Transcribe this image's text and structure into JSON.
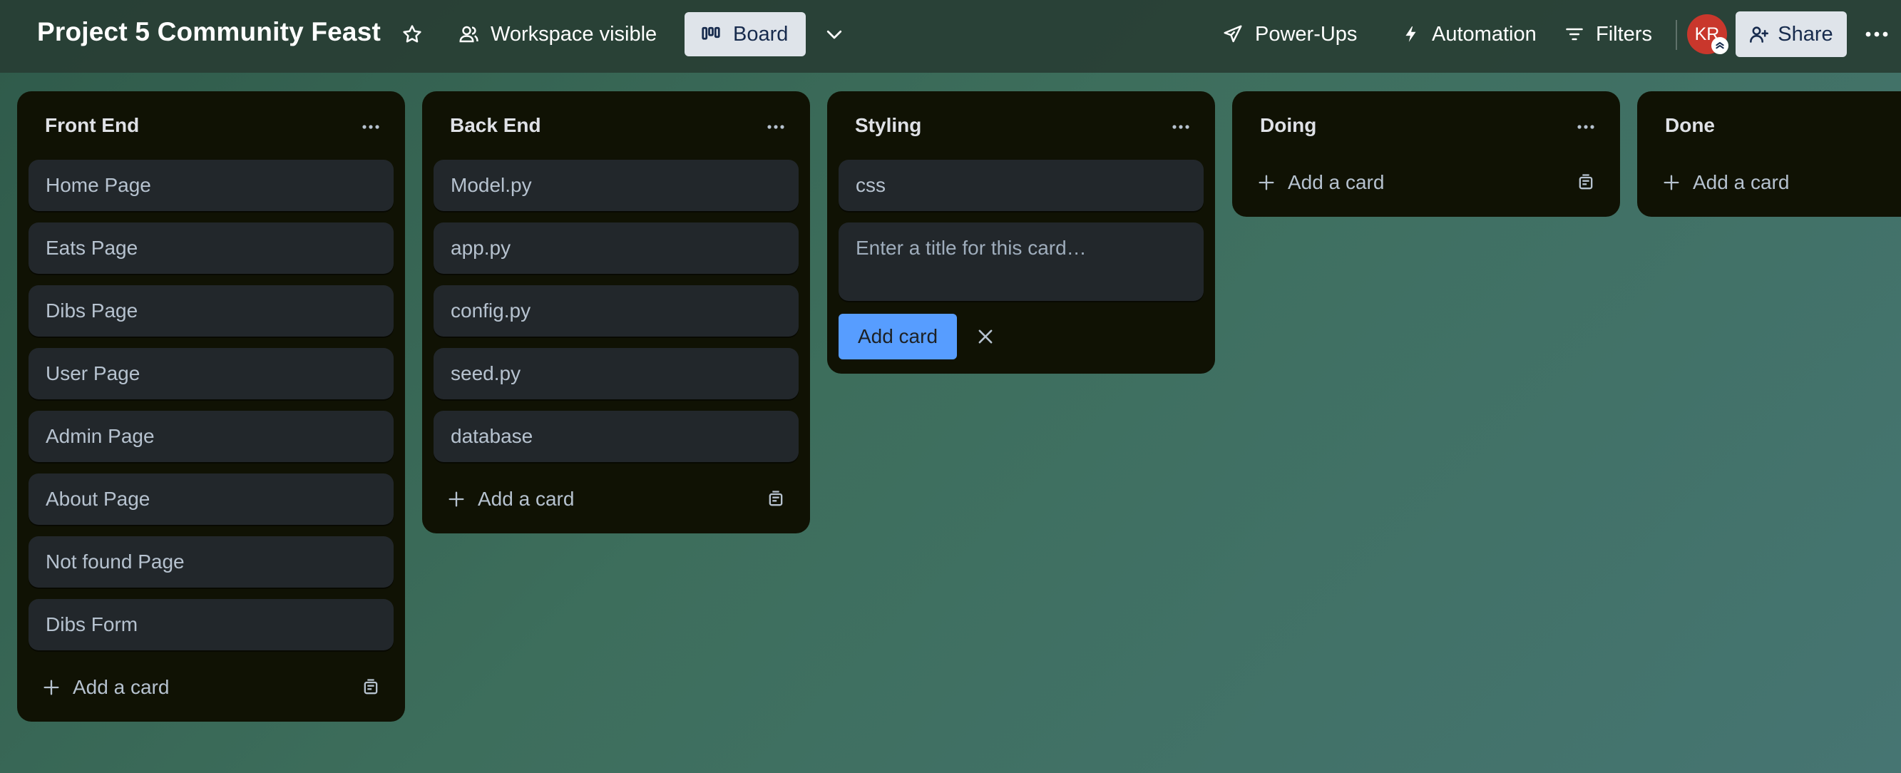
{
  "header": {
    "board_title": "Project 5 Community Feast",
    "visibility_label": "Workspace visible",
    "view_label": "Board",
    "powerups_label": "Power-Ups",
    "automation_label": "Automation",
    "filters_label": "Filters",
    "avatar_initials": "KR",
    "share_label": "Share"
  },
  "lists": [
    {
      "title": "Front End",
      "cards": [
        "Home Page",
        "Eats Page",
        "Dibs Page",
        "User Page",
        "Admin Page",
        "About Page",
        "Not found Page",
        "Dibs Form"
      ],
      "add_label": "Add a card"
    },
    {
      "title": "Back End",
      "cards": [
        "Model.py",
        "app.py",
        "config.py",
        "seed.py",
        "database"
      ],
      "add_label": "Add a card"
    },
    {
      "title": "Styling",
      "cards": [
        "css"
      ],
      "composer": {
        "placeholder": "Enter a title for this card…",
        "submit_label": "Add card"
      }
    },
    {
      "title": "Doing",
      "cards": [],
      "add_label": "Add a card"
    },
    {
      "title": "Done",
      "cards": [],
      "add_label": "Add a card"
    }
  ],
  "colors": {
    "accent_blue": "#579dff",
    "avatar_red": "#c9372c",
    "list_bg": "#101204",
    "card_bg": "#22272b"
  },
  "icons": [
    "star-icon",
    "people-icon",
    "board-icon",
    "chevron-down-icon",
    "rocket-icon",
    "lightning-icon",
    "filter-icon",
    "add-person-icon",
    "more-icon",
    "plus-icon",
    "template-icon",
    "close-icon"
  ]
}
